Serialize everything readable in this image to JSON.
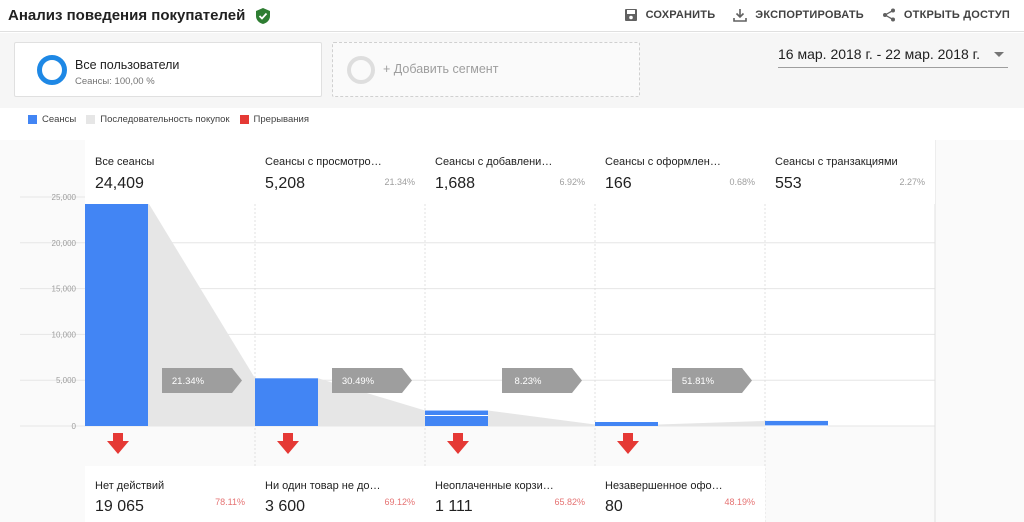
{
  "header": {
    "title": "Анализ поведения покупателей",
    "actions": {
      "save": "СОХРАНИТЬ",
      "export": "ЭКСПОРТИРОВАТЬ",
      "share": "ОТКРЫТЬ ДОСТУП"
    }
  },
  "segments": {
    "primary": {
      "title": "Все пользователи",
      "subtitle": "Сеансы: 100,00 %"
    },
    "add": {
      "label": "+ Добавить сегмент"
    }
  },
  "date_range": "16 мар. 2018 г. - 22 мар. 2018 г.",
  "legend": {
    "sessions": "Сеансы",
    "sequence": "Последовательность покупок",
    "abandon": "Прерывания"
  },
  "colors": {
    "accent": "#4285f4",
    "flow": "#e6e6e6",
    "abandon": "#e53935",
    "conversion_tag": "#9e9e9e"
  },
  "stages": [
    {
      "name": "Все сеансы",
      "value": "24,409",
      "pct": ""
    },
    {
      "name": "Сеансы с просмотром тов…",
      "value": "5,208",
      "pct": "21.34%"
    },
    {
      "name": "Сеансы с добавлением то…",
      "value": "1,688",
      "pct": "6.92%"
    },
    {
      "name": "Сеансы с оформлением п…",
      "value": "166",
      "pct": "0.68%"
    },
    {
      "name": "Сеансы с транзакциями",
      "value": "553",
      "pct": "2.27%"
    }
  ],
  "conversions": [
    "21.34%",
    "30.49%",
    "8.23%",
    "51.81%"
  ],
  "abandonments": [
    {
      "name": "Нет действий",
      "value": "19 065",
      "pct": "78.11%"
    },
    {
      "name": "Ни один товар не добавл…",
      "value": "3 600",
      "pct": "69.12%"
    },
    {
      "name": "Неоплаченные корзины п…",
      "value": "1 111",
      "pct": "65.82%"
    },
    {
      "name": "Незавершенное оформле…",
      "value": "80",
      "pct": "48.19%"
    }
  ],
  "chart_data": {
    "type": "bar",
    "categories": [
      "Все сеансы",
      "Сеансы с просмотром тов…",
      "Сеансы с добавлением то…",
      "Сеансы с оформлением п…",
      "Сеансы с транзакциями"
    ],
    "values": [
      24409,
      5208,
      1688,
      166,
      553
    ],
    "ylim": [
      0,
      25000
    ],
    "yticks": [
      "25,000",
      "20,000",
      "15,000",
      "10,000",
      "5,000",
      "0"
    ],
    "ytick_values": [
      25000,
      20000,
      15000,
      10000,
      5000,
      0
    ],
    "grid": true
  }
}
